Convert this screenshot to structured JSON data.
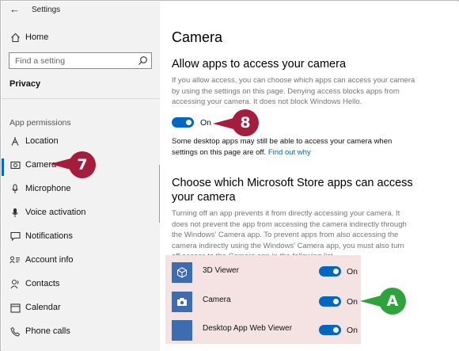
{
  "window": {
    "title": "Settings"
  },
  "sidebar": {
    "home_label": "Home",
    "search_placeholder": "Find a setting",
    "category": "Privacy",
    "section_label": "App permissions",
    "items": [
      {
        "label": "Location",
        "icon": "location-pin-icon"
      },
      {
        "label": "Camera",
        "icon": "camera-icon",
        "selected": true
      },
      {
        "label": "Microphone",
        "icon": "microphone-icon"
      },
      {
        "label": "Voice activation",
        "icon": "voice-activation-icon"
      },
      {
        "label": "Notifications",
        "icon": "notifications-icon"
      },
      {
        "label": "Account info",
        "icon": "account-info-icon"
      },
      {
        "label": "Contacts",
        "icon": "contacts-icon"
      },
      {
        "label": "Calendar",
        "icon": "calendar-icon"
      },
      {
        "label": "Phone calls",
        "icon": "phone-icon"
      }
    ]
  },
  "main": {
    "page_title": "Camera",
    "allow_heading": "Allow apps to access your camera",
    "allow_desc": [
      "If you allow access, you can choose which apps can access your camera",
      "by using the settings on this page. Denying access blocks apps from",
      "accessing your camera. It does not block Windows Hello."
    ],
    "allow_toggle_label": "On",
    "desktop_note_line1": "Some desktop apps may still be able to access your camera when",
    "desktop_note_line2": "settings on this page are off.",
    "find_out_why": "Find out why",
    "store_heading_line1": "Choose which Microsoft Store apps can access",
    "store_heading_line2": "your camera",
    "store_desc": [
      "Turning off an app prevents it from directly accessing your camera. It",
      "does not prevent the app from accessing the camera indirectly through",
      "the Windows' Camera app. To prevent apps from also accessing the",
      "camera indirectly using the Windows' Camera app, you must also turn",
      "off access to the Camera app in the following list."
    ],
    "apps": [
      {
        "name": "3D Viewer",
        "toggle": "On",
        "icon": "3d-viewer-icon"
      },
      {
        "name": "Camera",
        "toggle": "On",
        "icon": "camera-app-icon"
      },
      {
        "name": "Desktop App Web Viewer",
        "toggle": "On",
        "icon": "web-viewer-icon"
      }
    ]
  },
  "callouts": {
    "seven": "7",
    "eight": "8",
    "a": "A"
  },
  "colors": {
    "accent": "#0067c0",
    "callout_red": "#a51d3c",
    "callout_green": "#2fa23c",
    "app_tile": "#3e6cb0",
    "highlight": "#f5e3e4"
  }
}
